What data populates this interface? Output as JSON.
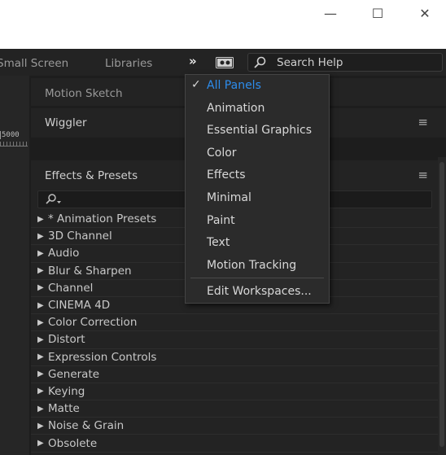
{
  "window": {
    "minimize_glyph": "—",
    "maximize_glyph": "☐",
    "close_glyph": "✕"
  },
  "workspace_bar": {
    "tabs": [
      "Small Screen",
      "Libraries"
    ],
    "more_glyph": "»",
    "settings_icon": "workspace-settings-icon",
    "search_placeholder": "Search Help"
  },
  "timeline": {
    "ruler_label": "5000"
  },
  "panels": {
    "motion_sketch": {
      "title": "Motion Sketch"
    },
    "wiggler": {
      "title": "Wiggler"
    },
    "effects_presets": {
      "title": "Effects & Presets",
      "items": [
        "* Animation Presets",
        "3D Channel",
        "Audio",
        "Blur & Sharpen",
        "Channel",
        "CINEMA 4D",
        "Color Correction",
        "Distort",
        "Expression Controls",
        "Generate",
        "Keying",
        "Matte",
        "Noise & Grain",
        "Obsolete"
      ]
    },
    "menu_glyph": "≡"
  },
  "workspace_menu": {
    "items": [
      {
        "label": "All Panels",
        "checked": true
      },
      {
        "label": "Animation",
        "checked": false
      },
      {
        "label": "Essential Graphics",
        "checked": false
      },
      {
        "label": "Color",
        "checked": false
      },
      {
        "label": "Effects",
        "checked": false
      },
      {
        "label": "Minimal",
        "checked": false
      },
      {
        "label": "Paint",
        "checked": false
      },
      {
        "label": "Text",
        "checked": false
      },
      {
        "label": "Motion Tracking",
        "checked": false
      }
    ],
    "edit_label": "Edit Workspaces...",
    "check_glyph": "✓"
  },
  "colors": {
    "accent_blue": "#2d8ceb",
    "panel_bg": "#232323",
    "menu_bg": "#2b2b2b"
  }
}
